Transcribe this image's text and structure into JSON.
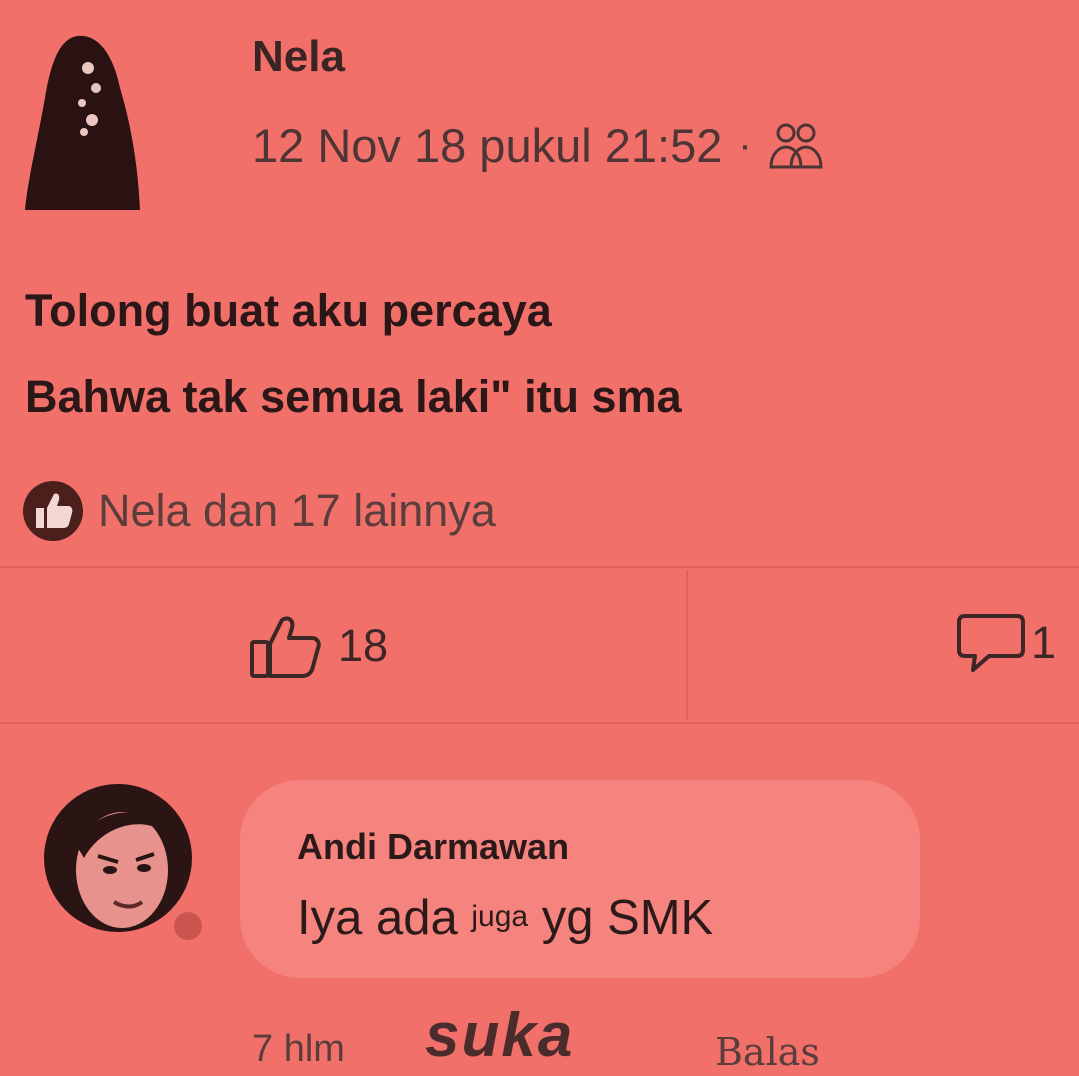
{
  "post": {
    "author": "Nela",
    "timestamp": "12 Nov 18 pukul 21:52",
    "separator": "·",
    "audience_icon": "friends-icon",
    "text_line1": "Tolong buat aku percaya",
    "text_line2": "Bahwa tak semua laki\" itu sma",
    "reactions_summary": "Nela dan 17 lainnya",
    "like_count": "18",
    "comment_count": "1"
  },
  "comment": {
    "author": "Andi Darmawan",
    "text_part1": "Iya ada ",
    "text_part2": "juga",
    "text_part3": " yg SMK",
    "time": "7 hlm",
    "like_label": "suka",
    "reply_label": "Balas"
  },
  "colors": {
    "background": "#f2706a",
    "bubble": "#f6847e",
    "text": "#2a1a1a"
  }
}
